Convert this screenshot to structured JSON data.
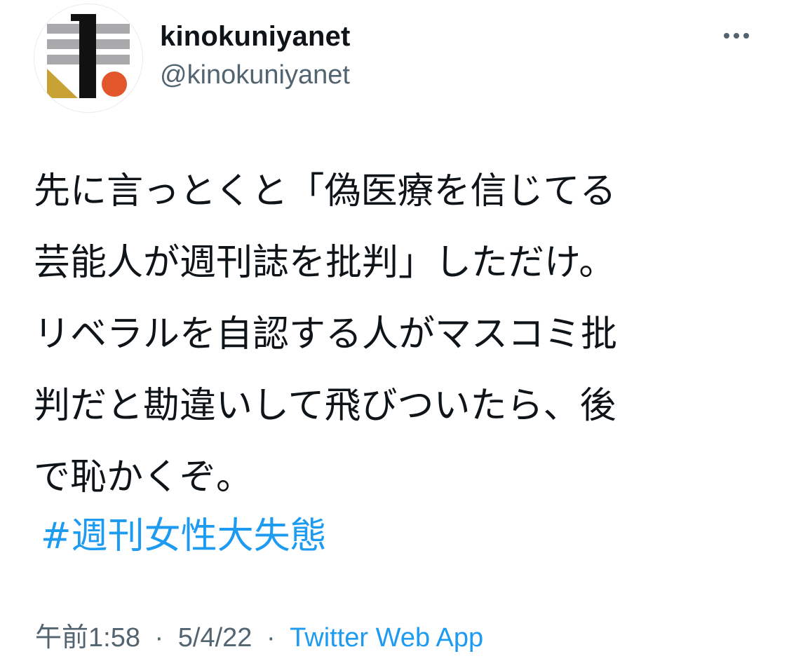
{
  "user": {
    "display_name": "kinokuniyanet",
    "handle": "@kinokuniyanet"
  },
  "tweet": {
    "lines": [
      "先に言っとくと「偽医療を信じてる",
      "芸能人が週刊誌を批判」しただけ。",
      "リベラルを自認する人がマスコミ批",
      "判だと勘違いして飛びついたら、後",
      "で恥かくぞ。"
    ],
    "hashtag": "#週刊女性大失態"
  },
  "meta": {
    "time": "午前1:58",
    "separator": "·",
    "date": "5/4/22",
    "source": "Twitter Web App"
  },
  "icons": {
    "more": "more-horizontal-icon",
    "avatar": "kinokuniya-logo"
  },
  "colors": {
    "text": "#0f1419",
    "secondary": "#536471",
    "link": "#1d9bf0",
    "logo_gray": "#a9a9ab",
    "logo_black": "#111111",
    "logo_gold": "#c9a235",
    "logo_orange": "#e2562c"
  }
}
